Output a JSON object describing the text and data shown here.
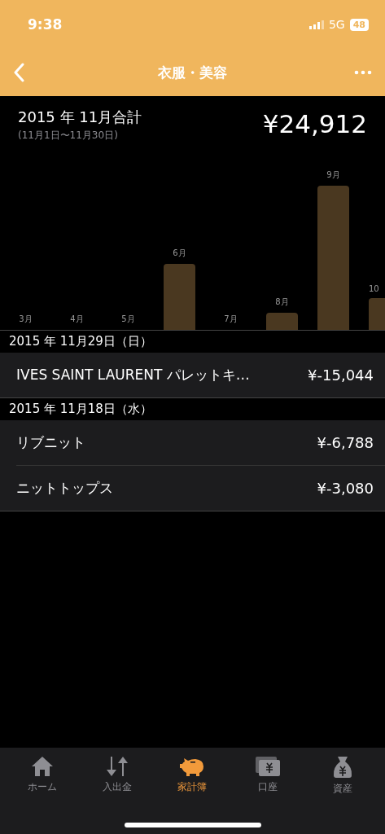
{
  "status_bar": {
    "time": "9:38",
    "network": "5G",
    "battery": "48"
  },
  "nav": {
    "title": "衣服・美容"
  },
  "summary": {
    "title": "2015 年 11月合計",
    "range": "(11月1日〜11月30日)",
    "total": "¥24,912"
  },
  "chart_bars": [
    {
      "label": "3月"
    },
    {
      "label": "4月"
    },
    {
      "label": "5月"
    },
    {
      "label": "6月"
    },
    {
      "label": "7月"
    },
    {
      "label": "8月"
    },
    {
      "label": "9月"
    },
    {
      "label": "10"
    }
  ],
  "sections": [
    {
      "date": "2015 年 11月29日（日）",
      "entries": [
        {
          "name": "IVES SAINT  LAURENT パレットキ…",
          "amount": "¥-15,044"
        }
      ]
    },
    {
      "date": "2015 年 11月18日（水）",
      "entries": [
        {
          "name": "リブニット",
          "amount": "¥-6,788"
        },
        {
          "name": "ニットトップス",
          "amount": "¥-3,080"
        }
      ]
    }
  ],
  "tabs": [
    {
      "label": "ホーム",
      "selected": false
    },
    {
      "label": "入出金",
      "selected": false
    },
    {
      "label": "家計簿",
      "selected": true
    },
    {
      "label": "口座",
      "selected": false
    },
    {
      "label": "資産",
      "selected": false
    }
  ]
}
